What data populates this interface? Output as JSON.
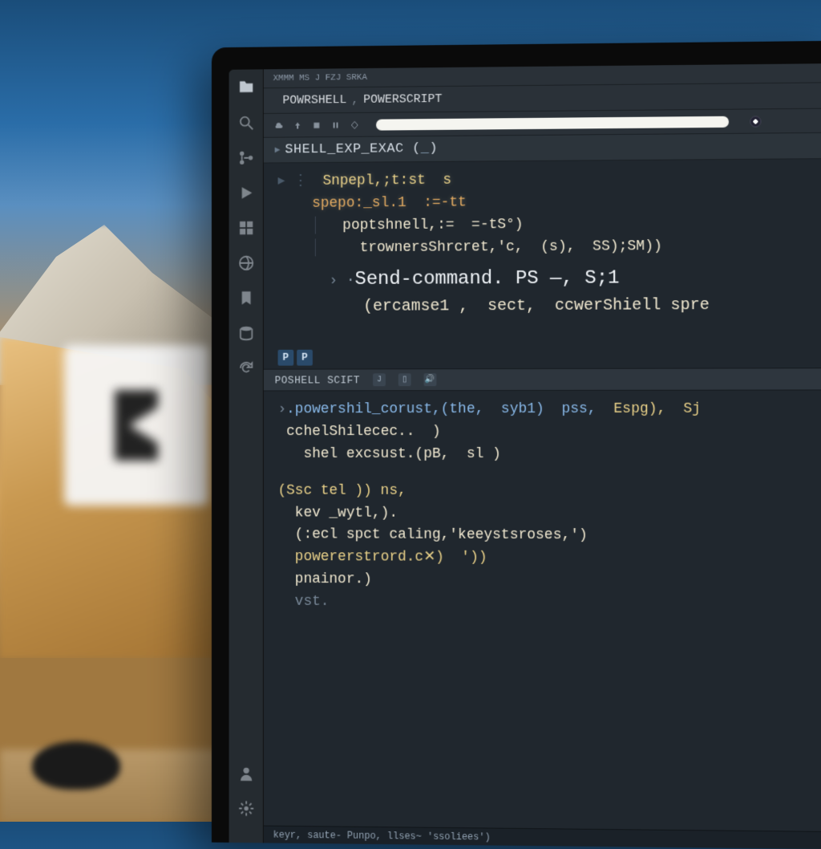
{
  "titlebar": {
    "menu": "XMMM  MS J FZJ SRKA"
  },
  "tabs": {
    "tab1": "POWRSHELL",
    "tab2": "POWERSCRIPT"
  },
  "breadcrumb": {
    "fn": "SHELL_EXP_EXAC (_)"
  },
  "editor_top": {
    "l1": "Snpepl,;t:st  s",
    "l2": "spepo:_sl.1  :=-tt",
    "l3": "poptshnell,:=  =-tS°)",
    "l4": "trownersShrcret,'c,  (s),  SS);SM))",
    "l5_cmd": "Send-command. PS —, S;1",
    "l6": "(ercamse1 ,  sect,  ccwerShiell spre"
  },
  "pp": {
    "a": "P",
    "b": "P"
  },
  "panel": {
    "title": "POSHELL SCIFT",
    "tab1": "J",
    "tab2": "▯"
  },
  "editor_bottom": {
    "l1a": ".powershil_corust,(the,  syb1)  pss,",
    "l1b": "  Espg),  Sj",
    "l2": "cchelShilecec..  )",
    "l3": "shel excsust.(pB,  sl )",
    "l4": "(Ssc tel )) ns,",
    "l5": "kev _wytl,).",
    "l6": "(:ecl spct caling,'keeystsroses,')",
    "l7": "powererstrord.c✕)  '))",
    "l8": "pnainor.)",
    "l9": "vst."
  },
  "statusbar": {
    "text": "keyr, saute-  Punpo, llses~        'ssoliees')"
  },
  "activity": {
    "items": [
      "explorer",
      "search",
      "source-control",
      "run-debug",
      "extensions",
      "remote",
      "account",
      "settings",
      "power"
    ]
  }
}
